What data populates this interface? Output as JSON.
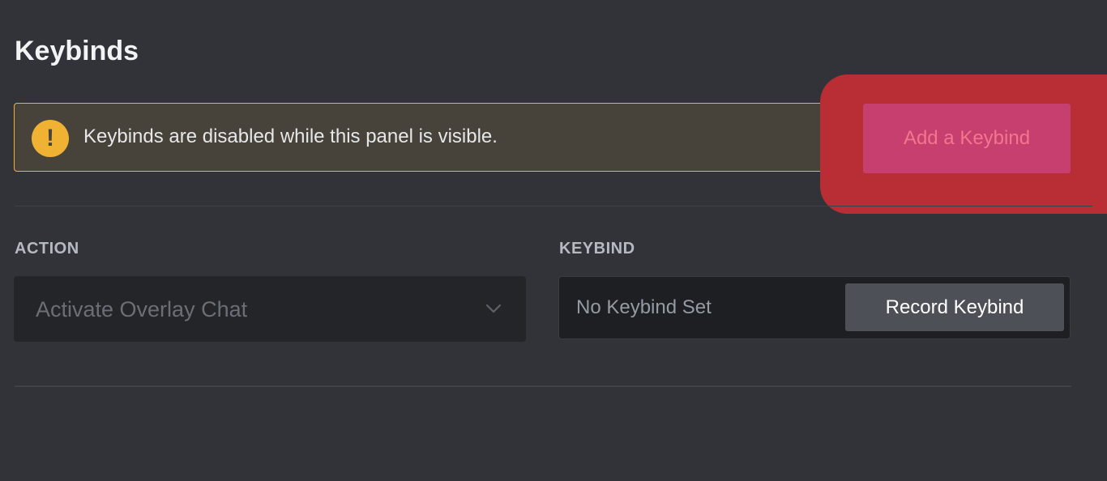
{
  "header": {
    "title": "Keybinds"
  },
  "notice": {
    "icon": "exclamation-icon",
    "icon_glyph": "!",
    "text": "Keybinds are disabled while this panel is visible."
  },
  "actions": {
    "add_label": "Add a Keybind"
  },
  "columns": {
    "action_label": "ACTION",
    "keybind_label": "KEYBIND"
  },
  "rows": [
    {
      "action": "Activate Overlay Chat",
      "keybind_placeholder": "No Keybind Set",
      "record_label": "Record Keybind"
    }
  ],
  "colors": {
    "background": "#313338",
    "warning_border": "#f0b232",
    "highlight": "#b92d35",
    "add_button": "#c73f6e"
  }
}
